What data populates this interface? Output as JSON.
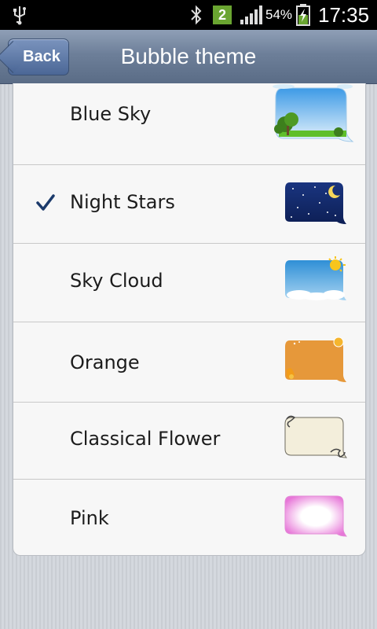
{
  "status_bar": {
    "usb_icon": "usb-icon",
    "bluetooth_icon": "bluetooth-icon",
    "notification_badge": "2",
    "signal_icon": "signal-icon",
    "battery_percent": "54%",
    "battery_icon": "battery-charging-icon",
    "time": "17:35"
  },
  "header": {
    "back_label": "Back",
    "title": "Bubble theme"
  },
  "themes": [
    {
      "label": "Blue Sky",
      "selected": false,
      "icon": "blue-sky-bubble-icon"
    },
    {
      "label": "Night Stars",
      "selected": true,
      "icon": "night-stars-bubble-icon"
    },
    {
      "label": "Sky Cloud",
      "selected": false,
      "icon": "sky-cloud-bubble-icon"
    },
    {
      "label": "Orange",
      "selected": false,
      "icon": "orange-bubble-icon"
    },
    {
      "label": "Classical Flower",
      "selected": false,
      "icon": "classical-flower-bubble-icon"
    },
    {
      "label": "Pink",
      "selected": false,
      "icon": "pink-bubble-icon"
    }
  ],
  "colors": {
    "accent": "#1b3a6b",
    "title_bar": "#6d7f99",
    "badge": "#6aa531"
  }
}
